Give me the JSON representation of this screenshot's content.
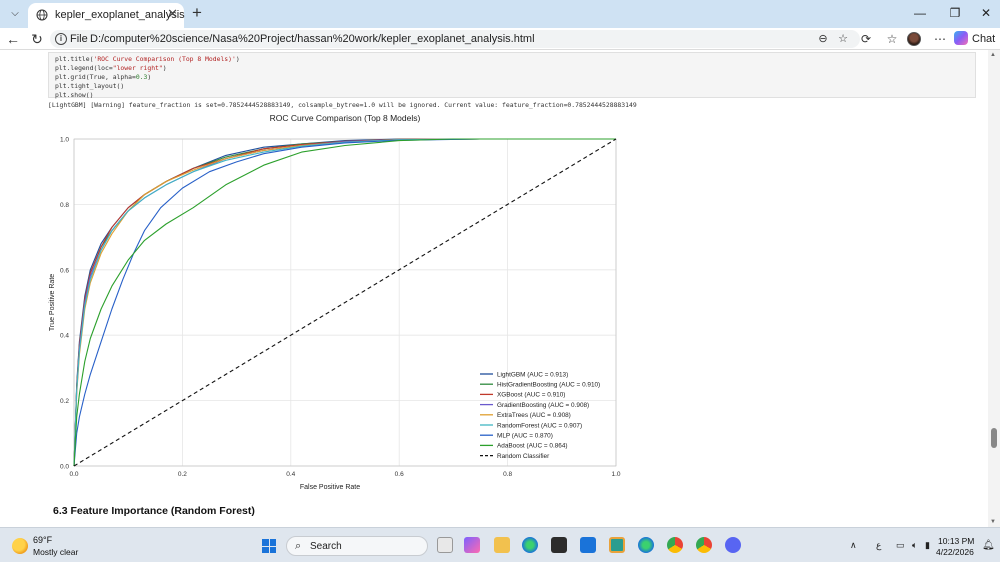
{
  "browser": {
    "tab_title": "kepler_exoplanet_analysis",
    "tab_close": "✕",
    "new_tab": "+",
    "address_label": "File",
    "url": "D:/computer%20science/Nasa%20Project/hassan%20work/kepler_exoplanet_analysis.html",
    "chat_label": "Chat"
  },
  "notebook": {
    "code_lines": [
      {
        "pre": "plt.title(",
        "str": "'ROC Curve Comparison (Top 8 Models)'",
        "post": ")"
      },
      {
        "pre": "plt.legend(loc=",
        "str": "\"lower right\"",
        "post": ")"
      },
      {
        "pre": "plt.grid(True, alpha=",
        "str": "",
        "num": "0.3",
        "post": ")"
      },
      {
        "pre": "plt.tight_layout()",
        "str": "",
        "post": ""
      },
      {
        "pre": "plt.show()",
        "str": "",
        "post": ""
      }
    ],
    "warning": "[LightGBM] [Warning] feature_fraction is set=0.7852444528883149, colsample_bytree=1.0 will be ignored. Current value: feature_fraction=0.7852444528883149",
    "next_heading": "6.3 Feature Importance (Random Forest)"
  },
  "chart_data": {
    "type": "line",
    "title": "ROC Curve Comparison (Top 8 Models)",
    "xlabel": "False Positive Rate",
    "ylabel": "True Positive Rate",
    "xlim": [
      0,
      1
    ],
    "ylim": [
      0,
      1
    ],
    "xticks": [
      "0.0",
      "0.2",
      "0.4",
      "0.6",
      "0.8",
      "1.0"
    ],
    "yticks": [
      "0.0",
      "0.2",
      "0.4",
      "0.6",
      "0.8",
      "1.0"
    ],
    "grid": true,
    "legend_position": "lower right",
    "series": [
      {
        "name": "LightGBM (AUC = 0.913)",
        "color": "#1f4e9c",
        "x": [
          0,
          0.005,
          0.01,
          0.02,
          0.03,
          0.05,
          0.07,
          0.1,
          0.13,
          0.17,
          0.22,
          0.28,
          0.35,
          0.42,
          0.5,
          0.6,
          0.75,
          1.0
        ],
        "y": [
          0,
          0.25,
          0.38,
          0.52,
          0.6,
          0.68,
          0.73,
          0.79,
          0.83,
          0.87,
          0.91,
          0.95,
          0.975,
          0.985,
          0.995,
          1.0,
          1.0,
          1.0
        ]
      },
      {
        "name": "HistGradientBoosting (AUC = 0.910)",
        "color": "#2e8b3e",
        "x": [
          0,
          0.005,
          0.01,
          0.02,
          0.03,
          0.05,
          0.07,
          0.1,
          0.13,
          0.17,
          0.22,
          0.28,
          0.35,
          0.42,
          0.5,
          0.6,
          0.75,
          1.0
        ],
        "y": [
          0,
          0.24,
          0.37,
          0.51,
          0.59,
          0.67,
          0.72,
          0.78,
          0.83,
          0.87,
          0.91,
          0.945,
          0.97,
          0.985,
          0.993,
          0.999,
          1.0,
          1.0
        ]
      },
      {
        "name": "XGBoost (AUC = 0.910)",
        "color": "#c0392b",
        "x": [
          0,
          0.005,
          0.01,
          0.02,
          0.03,
          0.05,
          0.07,
          0.1,
          0.13,
          0.17,
          0.22,
          0.28,
          0.35,
          0.42,
          0.5,
          0.6,
          0.75,
          1.0
        ],
        "y": [
          0,
          0.24,
          0.37,
          0.51,
          0.59,
          0.67,
          0.73,
          0.79,
          0.83,
          0.87,
          0.91,
          0.94,
          0.97,
          0.983,
          0.993,
          0.999,
          1.0,
          1.0
        ]
      },
      {
        "name": "GradientBoosting (AUC = 0.908)",
        "color": "#6a5acd",
        "x": [
          0,
          0.005,
          0.01,
          0.02,
          0.03,
          0.05,
          0.07,
          0.1,
          0.13,
          0.17,
          0.22,
          0.28,
          0.35,
          0.42,
          0.5,
          0.6,
          0.75,
          1.0
        ],
        "y": [
          0,
          0.23,
          0.36,
          0.5,
          0.58,
          0.66,
          0.72,
          0.78,
          0.82,
          0.86,
          0.9,
          0.94,
          0.965,
          0.98,
          0.992,
          0.998,
          1.0,
          1.0
        ]
      },
      {
        "name": "ExtraTrees (AUC = 0.908)",
        "color": "#e0a030",
        "x": [
          0,
          0.005,
          0.01,
          0.02,
          0.03,
          0.05,
          0.07,
          0.1,
          0.13,
          0.17,
          0.22,
          0.28,
          0.35,
          0.42,
          0.5,
          0.6,
          0.75,
          1.0
        ],
        "y": [
          0,
          0.22,
          0.34,
          0.48,
          0.56,
          0.65,
          0.71,
          0.78,
          0.83,
          0.87,
          0.905,
          0.94,
          0.965,
          0.98,
          0.99,
          0.998,
          1.0,
          1.0
        ]
      },
      {
        "name": "RandomForest (AUC = 0.907)",
        "color": "#41b6c4",
        "x": [
          0,
          0.005,
          0.01,
          0.02,
          0.03,
          0.05,
          0.07,
          0.1,
          0.13,
          0.17,
          0.22,
          0.28,
          0.35,
          0.42,
          0.5,
          0.6,
          0.75,
          1.0
        ],
        "y": [
          0,
          0.23,
          0.35,
          0.49,
          0.57,
          0.66,
          0.72,
          0.78,
          0.82,
          0.86,
          0.9,
          0.935,
          0.96,
          0.978,
          0.99,
          0.998,
          1.0,
          1.0
        ]
      },
      {
        "name": "MLP (AUC = 0.870)",
        "color": "#2860c8",
        "x": [
          0,
          0.005,
          0.01,
          0.02,
          0.03,
          0.05,
          0.07,
          0.09,
          0.11,
          0.13,
          0.16,
          0.2,
          0.25,
          0.3,
          0.35,
          0.42,
          0.5,
          0.6,
          0.75,
          1.0
        ],
        "y": [
          0,
          0.1,
          0.15,
          0.22,
          0.28,
          0.38,
          0.48,
          0.57,
          0.65,
          0.72,
          0.79,
          0.85,
          0.9,
          0.93,
          0.955,
          0.975,
          0.988,
          0.996,
          1.0,
          1.0
        ]
      },
      {
        "name": "AdaBoost (AUC = 0.864)",
        "color": "#2ca02c",
        "x": [
          0,
          0.005,
          0.01,
          0.02,
          0.03,
          0.05,
          0.07,
          0.1,
          0.13,
          0.17,
          0.22,
          0.28,
          0.35,
          0.42,
          0.5,
          0.6,
          0.7,
          0.85,
          1.0
        ],
        "y": [
          0,
          0.15,
          0.22,
          0.32,
          0.39,
          0.48,
          0.55,
          0.63,
          0.69,
          0.74,
          0.79,
          0.86,
          0.92,
          0.96,
          0.98,
          0.995,
          1.0,
          1.0,
          1.0
        ]
      },
      {
        "name": "Random Classifier",
        "color": "#111111",
        "dashed": true,
        "x": [
          0,
          1
        ],
        "y": [
          0,
          1
        ]
      }
    ]
  },
  "taskbar": {
    "weather_temp": "69°F",
    "weather_desc": "Mostly clear",
    "search_label": "Search",
    "time": "10:13 PM",
    "date": "4/22/2026",
    "lang": "ع"
  }
}
